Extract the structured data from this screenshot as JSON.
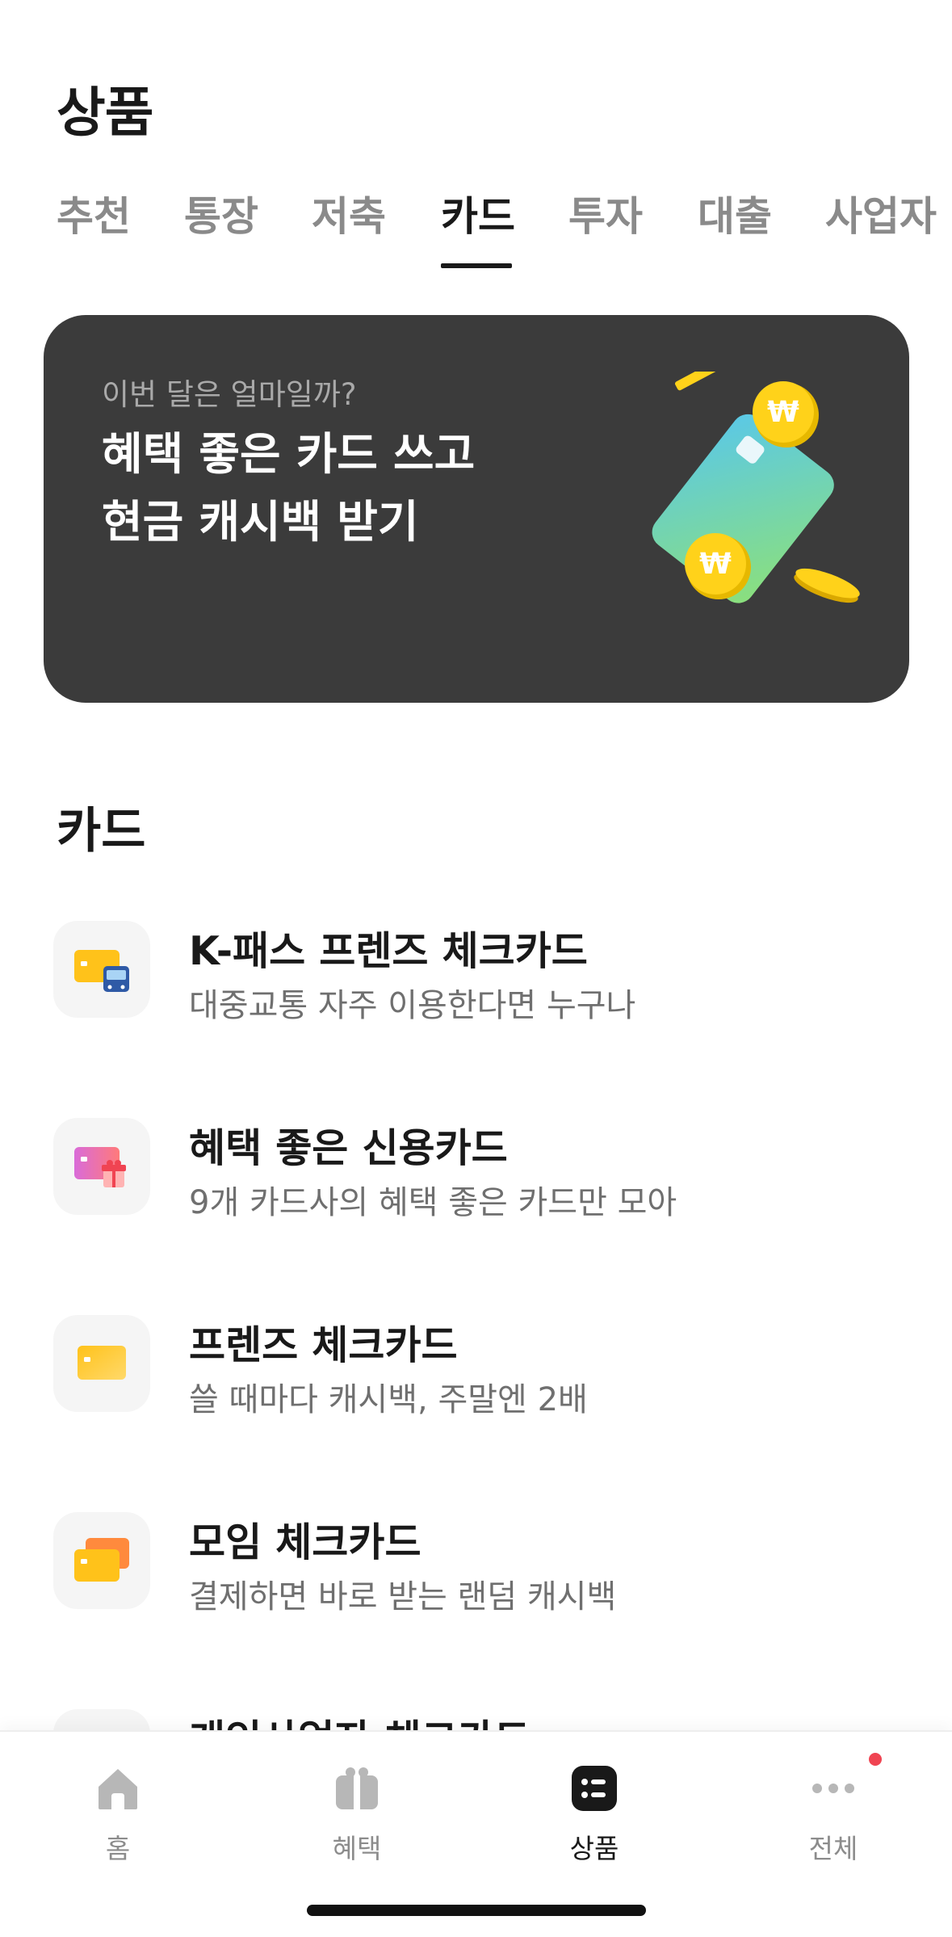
{
  "header": {
    "title": "상품"
  },
  "tabs": [
    {
      "label": "추천",
      "active": false
    },
    {
      "label": "통장",
      "active": false
    },
    {
      "label": "저축",
      "active": false
    },
    {
      "label": "카드",
      "active": true
    },
    {
      "label": "투자",
      "active": false
    },
    {
      "label": "대출",
      "active": false
    },
    {
      "label": "사업자",
      "active": false
    }
  ],
  "banner": {
    "eyebrow": "이번 달은 얼마일까?",
    "title_line1": "혜택 좋은 카드 쓰고",
    "title_line2": "현금 캐시백 받기",
    "illustration": "card-with-won-coins"
  },
  "section": {
    "title": "카드"
  },
  "products": [
    {
      "name": "K-패스 프렌즈 체크카드",
      "desc": "대중교통 자주 이용한다면 누구나",
      "icon": "card-bus-icon"
    },
    {
      "name": "혜택 좋은 신용카드",
      "desc": "9개 카드사의 혜택 좋은 카드만 모아",
      "icon": "card-gift-icon"
    },
    {
      "name": "프렌즈 체크카드",
      "desc": "쓸 때마다 캐시백, 주말엔 2배",
      "icon": "yellow-card-icon"
    },
    {
      "name": "모임 체크카드",
      "desc": "결제하면 바로 받는 랜덤 캐시백",
      "icon": "stacked-cards-icon"
    },
    {
      "name": "개인사업자 체크카드",
      "desc": "",
      "icon": "business-card-icon"
    }
  ],
  "bottom_nav": [
    {
      "label": "홈",
      "icon": "home-icon",
      "active": false
    },
    {
      "label": "혜택",
      "icon": "gift-icon",
      "active": false
    },
    {
      "label": "상품",
      "icon": "products-icon",
      "active": true
    },
    {
      "label": "전체",
      "icon": "more-icon",
      "active": false,
      "badge": true
    }
  ],
  "colors": {
    "accent": "#191919",
    "banner_bg": "#3b3b3b",
    "badge": "#f04452",
    "coin": "#ffd21a"
  }
}
